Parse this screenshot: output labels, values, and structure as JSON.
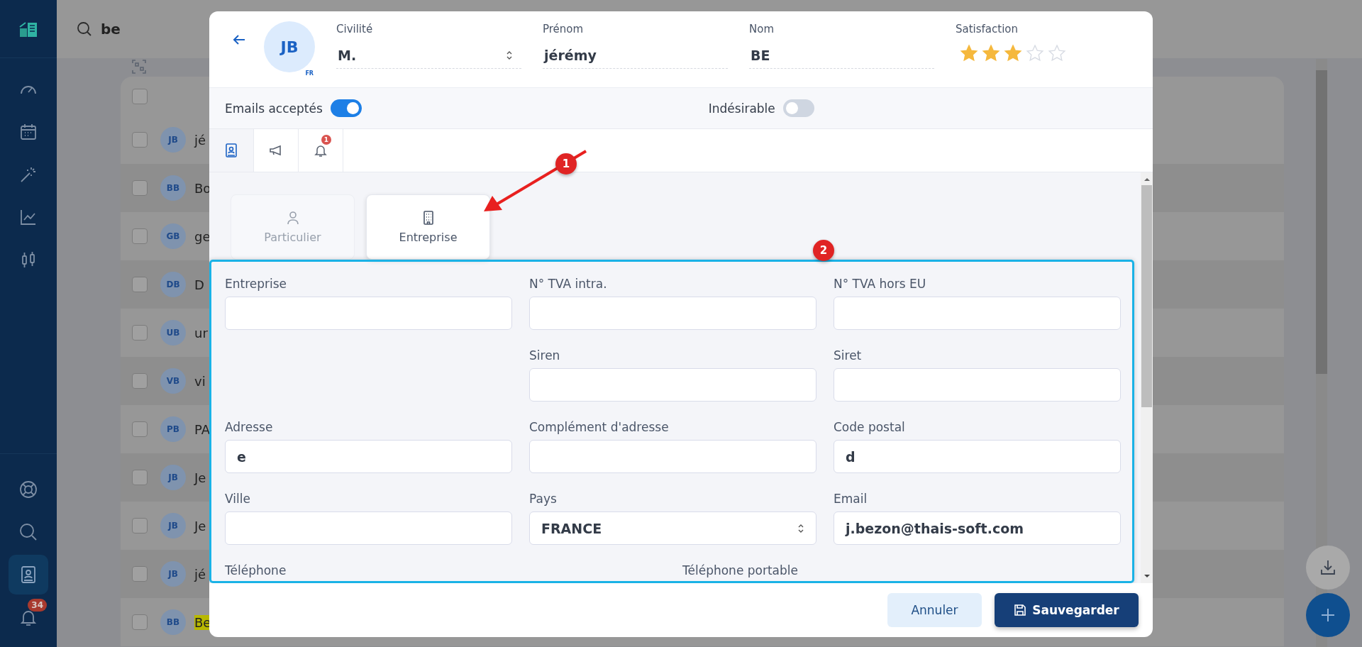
{
  "search": {
    "value": "be"
  },
  "sidebar": {
    "top_items": [
      {
        "selected": false
      },
      {
        "selected": false
      },
      {
        "selected": false
      },
      {
        "selected": false
      },
      {
        "selected": false
      }
    ],
    "bottom_items": [
      {
        "selected": false
      },
      {
        "selected": false
      },
      {
        "selected": true
      },
      {
        "selected": false,
        "badge": "34"
      }
    ]
  },
  "contacts_list": {
    "header_checked": false,
    "rows": [
      {
        "initials": "JB",
        "name": "jé",
        "checked": false,
        "highlighted": false
      },
      {
        "initials": "BB",
        "name": "Bo",
        "checked": false,
        "highlighted": false
      },
      {
        "initials": "GB",
        "name": "ge",
        "checked": false,
        "highlighted": false
      },
      {
        "initials": "DB",
        "name": "D",
        "checked": false,
        "highlighted": false
      },
      {
        "initials": "UB",
        "name": "ur",
        "checked": false,
        "highlighted": false
      },
      {
        "initials": "VB",
        "name": "vi",
        "checked": false,
        "highlighted": false
      },
      {
        "initials": "PB",
        "name": "PA",
        "checked": false,
        "highlighted": false
      },
      {
        "initials": "JB",
        "name": "Je",
        "checked": false,
        "highlighted": false
      },
      {
        "initials": "JB",
        "name": "Je",
        "checked": false,
        "highlighted": false
      },
      {
        "initials": "JB",
        "name": "jé",
        "checked": false,
        "highlighted": false
      },
      {
        "initials": "BB",
        "name": "Be",
        "checked": false,
        "highlighted": true
      }
    ]
  },
  "contact_dialog": {
    "avatar": {
      "initials": "JB",
      "locale": "FR"
    },
    "header_fields": [
      {
        "label": "Civilité",
        "value": "M.",
        "kind": "select"
      },
      {
        "label": "Prénom",
        "value": "jérémy",
        "kind": "text"
      },
      {
        "label": "Nom",
        "value": "BE",
        "kind": "text"
      }
    ],
    "satisfaction": {
      "label": "Satisfaction",
      "stars": 3
    },
    "toggles": [
      {
        "label": "Emails acceptés",
        "on": true
      },
      {
        "label": "Indésirable",
        "on": false
      }
    ],
    "tabs": [
      {
        "selected": true
      },
      {
        "selected": false
      },
      {
        "selected": false,
        "badge": "1"
      }
    ],
    "contact_types": [
      {
        "label": "Particulier",
        "selected": false
      },
      {
        "label": "Entreprise",
        "selected": true
      }
    ],
    "form_rows": [
      [
        {
          "label": "Entreprise",
          "kind": "text"
        },
        {
          "label": "N° TVA intra.",
          "kind": "text"
        },
        {
          "label": "N° TVA hors EU",
          "kind": "text"
        }
      ],
      [
        null,
        {
          "label": "Siren",
          "kind": "text"
        },
        {
          "label": "Siret",
          "kind": "text"
        }
      ],
      [
        {
          "label": "Adresse",
          "value": "e",
          "kind": "text"
        },
        {
          "label": "Complément d'adresse",
          "kind": "text"
        },
        {
          "label": "Code postal",
          "value": "d",
          "kind": "text"
        }
      ],
      [
        {
          "label": "Ville",
          "kind": "text"
        },
        {
          "label": "Pays",
          "value": "FRANCE",
          "kind": "select"
        },
        {
          "label": "Email",
          "value": "j.bezon@thais-soft.com",
          "kind": "text"
        }
      ]
    ],
    "form_last_row": [
      "Téléphone",
      "Téléphone portable"
    ],
    "annotations": [
      {
        "number": "1"
      },
      {
        "number": "2"
      }
    ],
    "buttons": [
      {
        "label": "Annuler",
        "kind": "secondary"
      },
      {
        "label": "Sauvegarder",
        "kind": "primary"
      }
    ]
  }
}
